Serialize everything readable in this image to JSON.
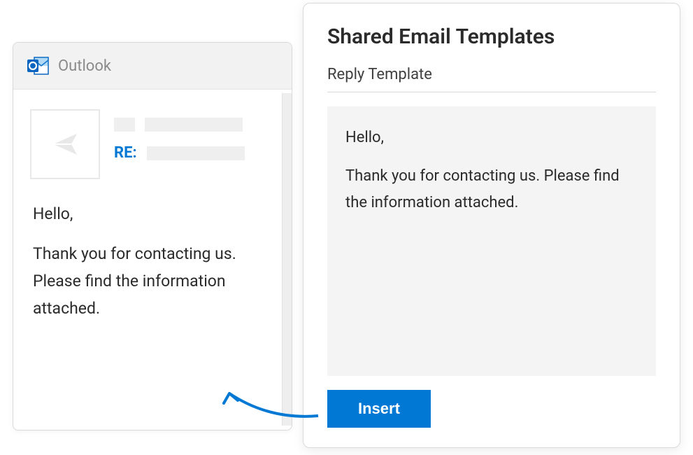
{
  "outlook": {
    "app_name": "Outlook",
    "reply_prefix": "RE:",
    "body_greeting": "Hello,",
    "body_text": "Thank you for contacting us. Please find the information attached."
  },
  "templates_panel": {
    "title": "Shared Email Templates",
    "template_name": "Reply Template",
    "body_greeting": "Hello,",
    "body_text": "Thank you for contacting us. Please find the information attached.",
    "insert_label": "Insert"
  },
  "colors": {
    "brand_blue": "#0078d4",
    "text_dark": "#2b2b2b",
    "text_muted": "#8a8a8a",
    "panel_bg": "#f4f4f4"
  }
}
